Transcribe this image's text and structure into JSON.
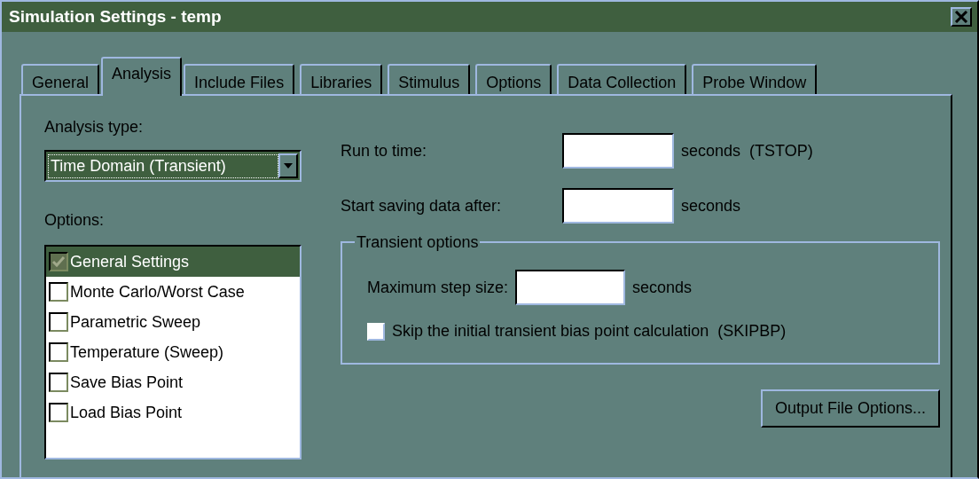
{
  "window": {
    "title": "Simulation Settings - temp"
  },
  "tabs": [
    {
      "label": "General",
      "selected": false
    },
    {
      "label": "Analysis",
      "selected": true
    },
    {
      "label": "Include Files",
      "selected": false
    },
    {
      "label": "Libraries",
      "selected": false
    },
    {
      "label": "Stimulus",
      "selected": false
    },
    {
      "label": "Options",
      "selected": false
    },
    {
      "label": "Data Collection",
      "selected": false
    },
    {
      "label": "Probe Window",
      "selected": false
    }
  ],
  "analysis_type": {
    "label": "Analysis type:",
    "value": "Time Domain (Transient)"
  },
  "options": {
    "label": "Options:",
    "items": [
      {
        "label": "General Settings",
        "checked": true,
        "selected": true
      },
      {
        "label": "Monte Carlo/Worst Case",
        "checked": false,
        "selected": false
      },
      {
        "label": "Parametric Sweep",
        "checked": false,
        "selected": false
      },
      {
        "label": "Temperature (Sweep)",
        "checked": false,
        "selected": false
      },
      {
        "label": "Save Bias Point",
        "checked": false,
        "selected": false
      },
      {
        "label": "Load Bias Point",
        "checked": false,
        "selected": false
      }
    ]
  },
  "fields": [
    {
      "label": "Run to time:",
      "unit": "seconds  (TSTOP)"
    },
    {
      "label": "Start saving data after:",
      "unit": "seconds"
    }
  ],
  "transient_options": {
    "title": "Transient options",
    "max_step": {
      "label": "Maximum step size:",
      "unit": "seconds"
    },
    "skip_bias": {
      "label": "Skip the initial transient bias point calculation  (SKIPBP)",
      "checked": false
    }
  },
  "output_button": "Output File Options..."
}
